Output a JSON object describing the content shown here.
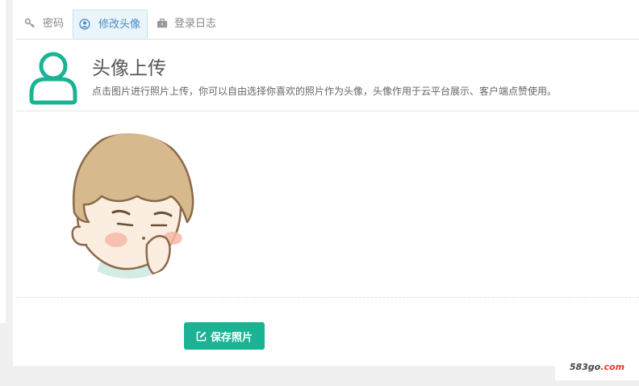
{
  "tabs": [
    {
      "label": "密码",
      "icon": "key-icon",
      "active": false
    },
    {
      "label": "修改头像",
      "icon": "user-circle-icon",
      "active": true
    },
    {
      "label": "登录日志",
      "icon": "briefcase-icon",
      "active": false
    }
  ],
  "hero": {
    "icon": "user-outline-icon",
    "title": "头像上传",
    "description": "点击图片进行照片上传，你可以自由选择你喜欢的照片作为头像，头像作用于云平台展示、客户端点赞使用。"
  },
  "avatar": {
    "alt": "cartoon-boy-avatar"
  },
  "save_button": {
    "icon": "edit-icon",
    "label": "保存照片"
  },
  "watermark": {
    "part1": "583go",
    "part2": ".com"
  },
  "colors": {
    "accent": "#1ab394",
    "tab_active": "#4a8ac4"
  }
}
